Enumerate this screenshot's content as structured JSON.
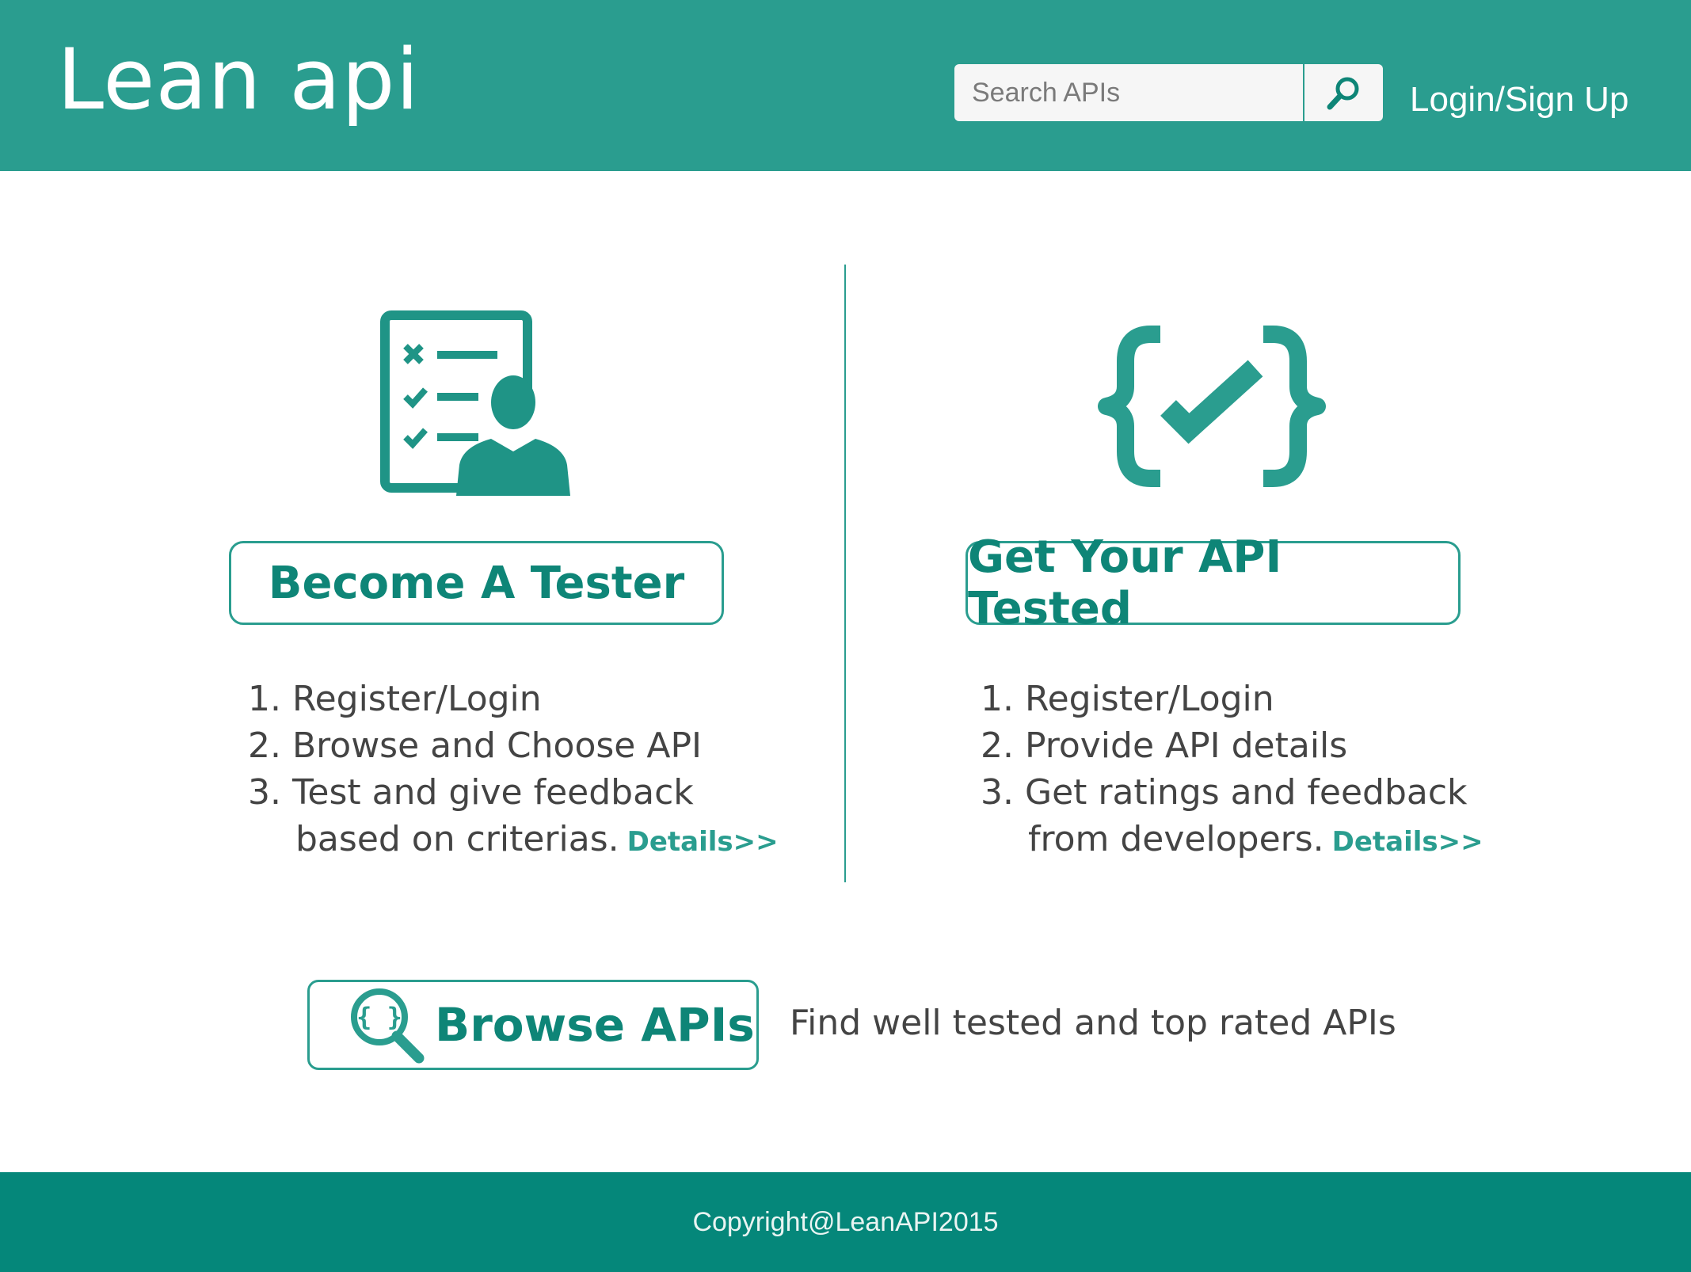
{
  "header": {
    "logo": "Lean api",
    "search": {
      "placeholder": "Search APIs",
      "button_icon": "search-icon"
    },
    "login_label": "Login/Sign Up"
  },
  "tester": {
    "icon": "tester-checklist-icon",
    "button_label": "Become A Tester",
    "steps": [
      "1. Register/Login",
      "2. Browse and Choose API",
      "3. Test and give feedback"
    ],
    "step3_continuation": "based on criterias.",
    "details_label": "Details>>"
  },
  "api_owner": {
    "icon": "code-check-icon",
    "button_label": "Get Your API Tested",
    "steps": [
      "1. Register/Login",
      "2. Provide API details",
      "3. Get ratings and feedback"
    ],
    "step3_continuation": "from developers.",
    "details_label": "Details>>"
  },
  "browse": {
    "icon": "browse-api-search-icon",
    "button_label": "Browse APIs",
    "description": "Find well tested and top rated APIs"
  },
  "footer": {
    "copyright": "Copyright@LeanAPI2015"
  },
  "colors": {
    "header_bg": "#2a9d8f",
    "footer_bg": "#05877a",
    "accent": "#0e8577",
    "text": "#444444"
  }
}
